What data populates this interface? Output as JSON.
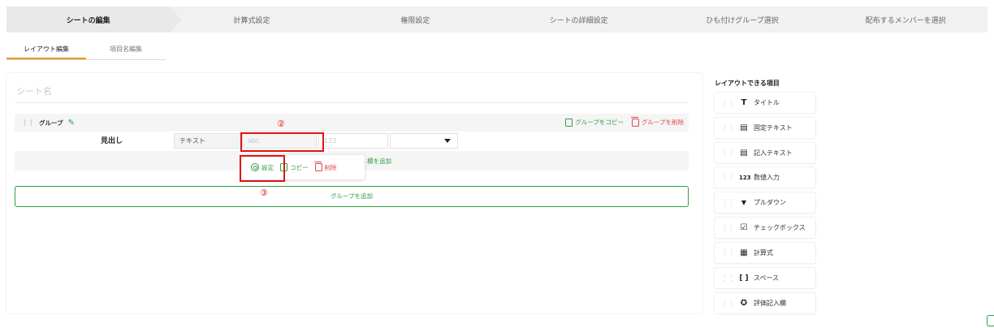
{
  "stepper": [
    {
      "label": "シートの編集",
      "active": true
    },
    {
      "label": "計算式設定",
      "active": false
    },
    {
      "label": "権限設定",
      "active": false
    },
    {
      "label": "シートの詳細設定",
      "active": false
    },
    {
      "label": "ひも付けグループ選択",
      "active": false
    },
    {
      "label": "配布するメンバーを選択",
      "active": false
    }
  ],
  "subtabs": [
    {
      "label": "レイアウト編集",
      "active": true
    },
    {
      "label": "項目名編集",
      "active": false
    }
  ],
  "sheet": {
    "name_placeholder": "シート名",
    "group_title": "グループ",
    "copy_group": "グループをコピー",
    "delete_group": "グループを削除",
    "row_label": "見出し",
    "field_type": "テキスト",
    "field_text_placeholder": "abc",
    "field_number_placeholder": "123",
    "add_item_suffix": "欄を追加",
    "add_group": "グループを追加"
  },
  "popup": {
    "settings": "設定",
    "copy": "コピー",
    "delete": "削除"
  },
  "annotations": {
    "mark2": "②",
    "mark3": "③"
  },
  "palette": {
    "title": "レイアウトできる項目",
    "items": [
      {
        "icon": "title-icon",
        "glyph": "T",
        "label": "タイトル"
      },
      {
        "icon": "fixed-text-icon",
        "glyph": "▤",
        "label": "固定テキスト"
      },
      {
        "icon": "input-text-icon",
        "glyph": "▤",
        "label": "記入テキスト"
      },
      {
        "icon": "number-input-icon",
        "glyph": "123",
        "label": "数値入力"
      },
      {
        "icon": "dropdown-icon",
        "glyph": "▼",
        "label": "プルダウン"
      },
      {
        "icon": "checkbox-icon",
        "glyph": "☑",
        "label": "チェックボックス"
      },
      {
        "icon": "formula-icon",
        "glyph": "▦",
        "label": "計算式"
      },
      {
        "icon": "space-icon",
        "glyph": "[ ]",
        "label": "スペース"
      },
      {
        "icon": "evaluation-icon",
        "glyph": "✪",
        "label": "評価記入欄"
      }
    ]
  },
  "colors": {
    "accent_green": "#2e9e43",
    "delete_red": "#e04848",
    "highlight_red": "#e01414",
    "tab_underline": "#e8931f"
  }
}
